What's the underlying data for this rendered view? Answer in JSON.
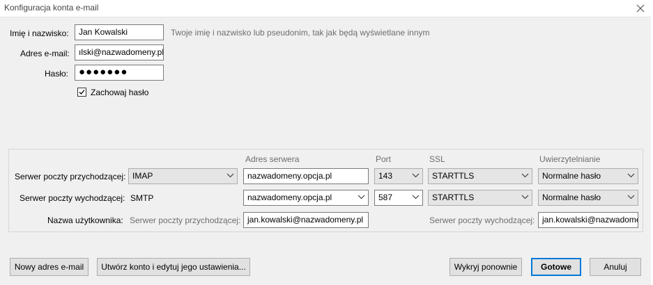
{
  "window": {
    "title": "Konfiguracja konta e-mail"
  },
  "identity": {
    "name_label": "Imię i nazwisko:",
    "name_value": "Jan Kowalski",
    "name_hint": "Twoje imię i nazwisko lub pseudonim, tak jak będą wyświetlane innym",
    "email_label": "Adres e-mail:",
    "email_value": "ılski@nazwadomeny.pl",
    "password_label": "Hasło:",
    "password_value": "●●●●●●●",
    "remember_label": "Zachowaj hasło",
    "remember_checked": true
  },
  "servers": {
    "col_address": "Adres serwera",
    "col_port": "Port",
    "col_ssl": "SSL",
    "col_auth": "Uwierzytelnianie",
    "incoming": {
      "label": "Serwer poczty przychodzącej:",
      "protocol": "IMAP",
      "address": "nazwadomeny.opcja.pl",
      "port": "143",
      "ssl": "STARTTLS",
      "auth": "Normalne hasło"
    },
    "outgoing": {
      "label": "Serwer poczty wychodzącej:",
      "protocol": "SMTP",
      "address": "nazwadomeny.opcja.pl",
      "port": "587",
      "ssl": "STARTTLS",
      "auth": "Normalne hasło"
    },
    "username": {
      "label": "Nazwa użytkownika:",
      "incoming_label": "Serwer poczty przychodzącej:",
      "incoming_value": "jan.kowalski@nazwadomeny.pl",
      "outgoing_label": "Serwer poczty wychodzącej:",
      "outgoing_value": "jan.kowalski@nazwadomeny.pl"
    }
  },
  "buttons": {
    "new_email": "Nowy adres e-mail",
    "create_edit": "Utwórz konto i edytuj jego ustawienia...",
    "redetect": "Wykryj ponownie",
    "done": "Gotowe",
    "cancel": "Anuluj"
  },
  "icons": {
    "close": "close-icon",
    "checkbox": "checkmark-icon",
    "dropdown": "chevron-down-icon"
  }
}
